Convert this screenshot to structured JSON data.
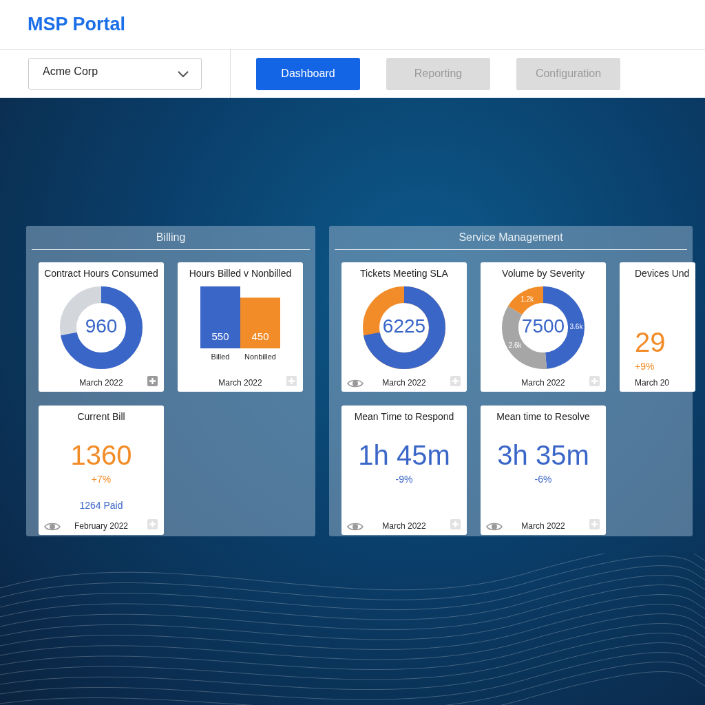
{
  "header": {
    "title": "MSP Portal"
  },
  "toolbar": {
    "customer_select": {
      "value": "Acme Corp"
    },
    "tabs": [
      {
        "label": "Dashboard",
        "selected": true
      },
      {
        "label": "Reporting",
        "selected": false
      },
      {
        "label": "Configuration",
        "selected": false
      }
    ]
  },
  "panels": [
    {
      "title": "Billing",
      "tiles": [
        {
          "kind": "donut",
          "title": "Contract Hours Consumed",
          "value": "960",
          "level": 0.72,
          "color": "#d3d7dc",
          "date": "March 2022",
          "eye": false,
          "add_enabled": true
        },
        {
          "kind": "chart",
          "title": "Hours Billed v Nonbilled",
          "chart_data": {
            "type": "bar",
            "categories": [
              "Billed",
              "Nonbilled"
            ],
            "values": [
              550,
              450
            ],
            "data_labels": true
          },
          "date": "March 2022",
          "eye": false,
          "add_enabled": false
        },
        {
          "kind": "stat",
          "title": "Current Bill",
          "value": "1360",
          "change": "+7%",
          "color": "#f28c28",
          "note": "1264 Paid",
          "date": "February 2022",
          "eye": true,
          "add_enabled": false
        }
      ]
    },
    {
      "title": "Service Management",
      "tiles": [
        {
          "kind": "donut",
          "title": "Tickets Meeting SLA",
          "value": "6225",
          "level": 0.72,
          "color": "#f28c28",
          "date": "March 2022",
          "eye": true,
          "add_enabled": false
        },
        {
          "kind": "chart",
          "title": "Volume by Severity",
          "value": "7500",
          "chart_data": {
            "type": "donut",
            "values": [
              3600,
              2600,
              1200
            ],
            "value_labels": [
              "3.6k",
              "2.6k",
              "1.2k"
            ]
          },
          "date": "March 2022",
          "eye": false,
          "add_enabled": false
        },
        {
          "kind": "partial",
          "title": "Devices Und",
          "value": "29",
          "change": "+9%",
          "color": "#f28c28",
          "date": "March 20"
        },
        {
          "kind": "stat",
          "title": "Mean Time to Respond",
          "value": "1h 45m",
          "change": "-9%",
          "color": "#3a66c8",
          "date": "March 2022",
          "eye": true,
          "add_enabled": false
        },
        {
          "kind": "stat",
          "title": "Mean time to Resolve",
          "value": "3h 35m",
          "change": "-6%",
          "color": "#3a66c8",
          "date": "March 2022",
          "eye": true,
          "add_enabled": false
        }
      ]
    }
  ]
}
